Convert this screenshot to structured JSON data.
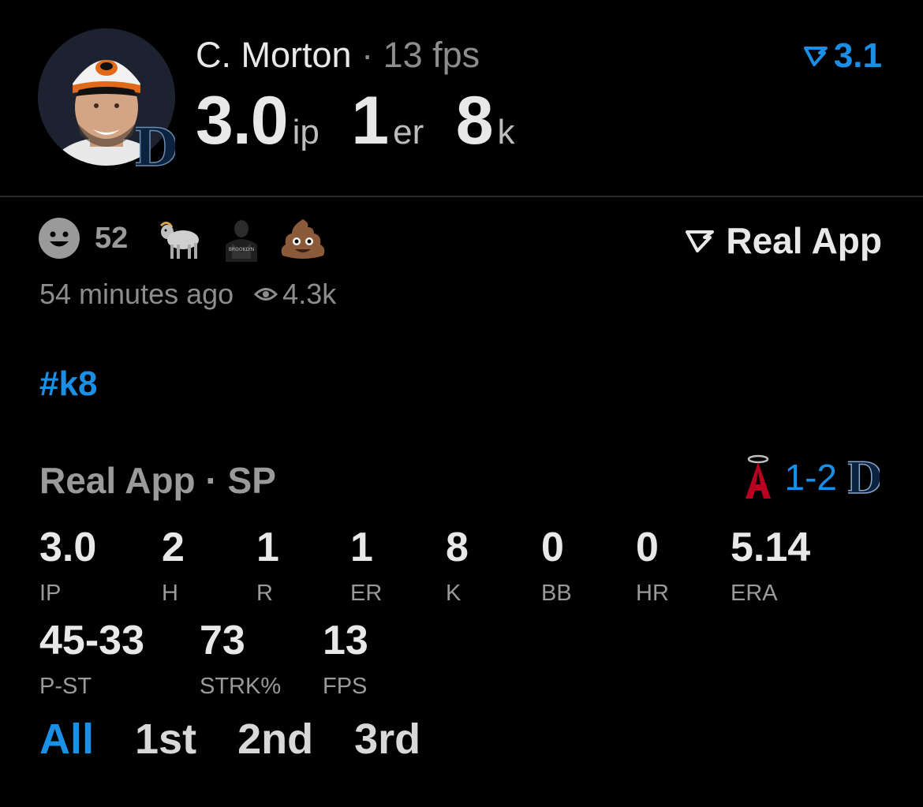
{
  "header": {
    "player_name": "C. Morton",
    "separator": "·",
    "fps_text": "13 fps",
    "ip_value": "3.0",
    "ip_unit": "ip",
    "er_value": "1",
    "er_unit": "er",
    "k_value": "8",
    "k_unit": "k",
    "top_score": "3.1",
    "accent_color": "#1a8fe6"
  },
  "reactions": {
    "count": "52",
    "icons": [
      "smiley-icon",
      "goat-emoji",
      "brooklyn-player-emoji",
      "poop-emoji"
    ]
  },
  "source": {
    "label": "Real App"
  },
  "meta": {
    "time_ago": "54 minutes ago",
    "views": "4.3k"
  },
  "hashtag": "#k8",
  "game": {
    "title": "Real App · SP",
    "score": "1-2",
    "stats_row1": [
      {
        "value": "3.0",
        "label": "IP"
      },
      {
        "value": "2",
        "label": "H"
      },
      {
        "value": "1",
        "label": "R"
      },
      {
        "value": "1",
        "label": "ER"
      },
      {
        "value": "8",
        "label": "K"
      },
      {
        "value": "0",
        "label": "BB"
      },
      {
        "value": "0",
        "label": "HR"
      },
      {
        "value": "5.14",
        "label": "ERA"
      }
    ],
    "stats_row2": [
      {
        "value": "45-33",
        "label": "P-ST"
      },
      {
        "value": "73",
        "label": "STRK%"
      },
      {
        "value": "13",
        "label": "FPS"
      }
    ]
  },
  "tabs": [
    "All",
    "1st",
    "2nd",
    "3rd"
  ]
}
